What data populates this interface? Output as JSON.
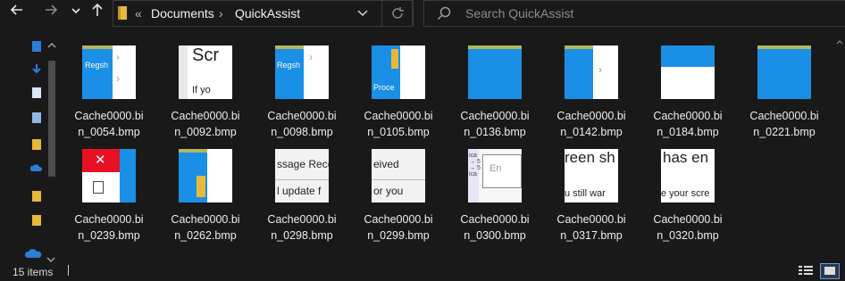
{
  "nav": {
    "back_icon": "arrow-left-icon",
    "forward_icon": "arrow-right-icon",
    "recent_icon": "chevron-down-icon",
    "up_icon": "arrow-up-icon"
  },
  "address": {
    "overflow": "«",
    "crumbs": [
      "Documents",
      "QuickAssist"
    ],
    "separator": "›"
  },
  "search": {
    "placeholder": "Search QuickAssist"
  },
  "files": [
    {
      "name": "Cache0000.bin_0054.bmp",
      "line1": "Cache0000.bi",
      "line2": "n_0054.bmp",
      "thumb_text": "Regsh"
    },
    {
      "name": "Cache0000.bin_0092.bmp",
      "line1": "Cache0000.bi",
      "line2": "n_0092.bmp",
      "thumb_text": "Scr"
    },
    {
      "name": "Cache0000.bin_0098.bmp",
      "line1": "Cache0000.bi",
      "line2": "n_0098.bmp",
      "thumb_text": "Regsh"
    },
    {
      "name": "Cache0000.bin_0105.bmp",
      "line1": "Cache0000.bi",
      "line2": "n_0105.bmp",
      "thumb_text": "Proce"
    },
    {
      "name": "Cache0000.bin_0136.bmp",
      "line1": "Cache0000.bi",
      "line2": "n_0136.bmp",
      "thumb_text": ""
    },
    {
      "name": "Cache0000.bin_0142.bmp",
      "line1": "Cache0000.bi",
      "line2": "n_0142.bmp",
      "thumb_text": ""
    },
    {
      "name": "Cache0000.bin_0184.bmp",
      "line1": "Cache0000.bi",
      "line2": "n_0184.bmp",
      "thumb_text": ""
    },
    {
      "name": "Cache0000.bin_0221.bmp",
      "line1": "Cache0000.bi",
      "line2": "n_0221.bmp",
      "thumb_text": ""
    },
    {
      "name": "Cache0000.bin_0239.bmp",
      "line1": "Cache0000.bi",
      "line2": "n_0239.bmp",
      "thumb_text": ""
    },
    {
      "name": "Cache0000.bin_0262.bmp",
      "line1": "Cache0000.bi",
      "line2": "n_0262.bmp",
      "thumb_text": ""
    },
    {
      "name": "Cache0000.bin_0298.bmp",
      "line1": "Cache0000.bi",
      "line2": "n_0298.bmp",
      "thumb_text": "ssage Rece"
    },
    {
      "name": "Cache0000.bin_0299.bmp",
      "line1": "Cache0000.bi",
      "line2": "n_0299.bmp",
      "thumb_text": "eived"
    },
    {
      "name": "Cache0000.bin_0300.bmp",
      "line1": "Cache0000.bi",
      "line2": "n_0300.bmp",
      "thumb_text": "En"
    },
    {
      "name": "Cache0000.bin_0317.bmp",
      "line1": "Cache0000.bi",
      "line2": "n_0317.bmp",
      "thumb_text": "reen sh"
    },
    {
      "name": "Cache0000.bin_0320.bmp",
      "line1": "Cache0000.bi",
      "line2": "n_0320.bmp",
      "thumb_text": "has en"
    }
  ],
  "status": {
    "count": "15 items"
  },
  "colors": {
    "background": "#191919",
    "accent_blue": "#0078d7",
    "folder_yellow": "#e8b83a"
  }
}
